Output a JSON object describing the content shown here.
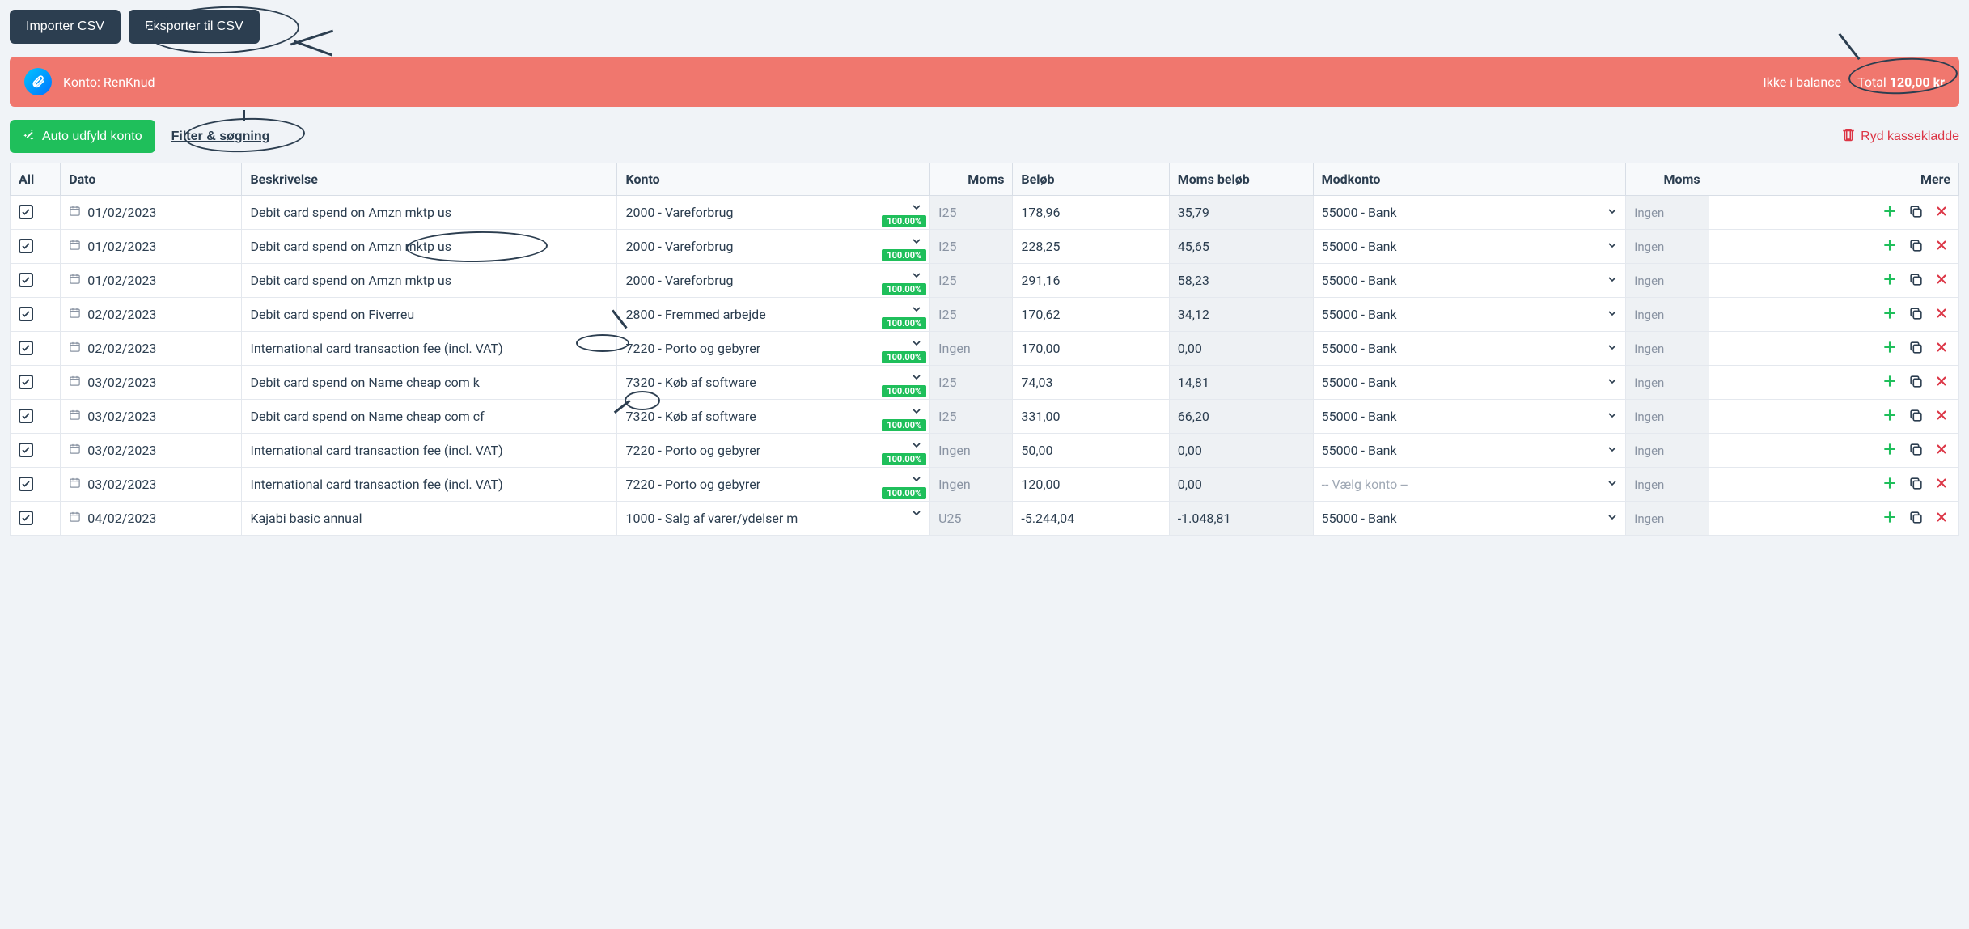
{
  "buttons": {
    "import_csv": "Importer CSV",
    "export_csv": "Eksporter til CSV",
    "auto_fill": "Auto udfyld konto",
    "filter_search": "Filter & søgning",
    "clear_journal": "Ryd kassekladde"
  },
  "banner": {
    "account_label": "Konto:",
    "account_name": "RenKnud",
    "not_balanced": "Ikke i balance",
    "total_label": "Total",
    "total_value": "120,00 kr"
  },
  "table": {
    "headers": {
      "all": "All",
      "date": "Dato",
      "description": "Beskrivelse",
      "account": "Konto",
      "vat": "Moms",
      "amount": "Beløb",
      "vat_amount": "Moms beløb",
      "contra": "Modkonto",
      "vat2": "Moms",
      "more": "Mere"
    },
    "badge_100": "100.00%",
    "moms2_default": "Ingen",
    "modkonto_placeholder": "-- Vælg konto --",
    "rows": [
      {
        "date": "01/02/2023",
        "desc": "Debit card spend on Amzn mktp us",
        "konto": "2000 - Vareforbrug",
        "moms": "I25",
        "amount": "178,96",
        "vat_amount": "35,79",
        "modkonto": "55000 - Bank",
        "has_confidence": true
      },
      {
        "date": "01/02/2023",
        "desc": "Debit card spend on Amzn mktp us",
        "konto": "2000 - Vareforbrug",
        "moms": "I25",
        "amount": "228,25",
        "vat_amount": "45,65",
        "modkonto": "55000 - Bank",
        "has_confidence": true
      },
      {
        "date": "01/02/2023",
        "desc": "Debit card spend on Amzn mktp us",
        "konto": "2000 - Vareforbrug",
        "moms": "I25",
        "amount": "291,16",
        "vat_amount": "58,23",
        "modkonto": "55000 - Bank",
        "has_confidence": true
      },
      {
        "date": "02/02/2023",
        "desc": "Debit card spend on Fiverreu",
        "konto": "2800 - Fremmed arbejde",
        "moms": "I25",
        "amount": "170,62",
        "vat_amount": "34,12",
        "modkonto": "55000 - Bank",
        "has_confidence": true
      },
      {
        "date": "02/02/2023",
        "desc": "International card transaction fee (incl. VAT)",
        "konto": "7220 - Porto og gebyrer",
        "moms": "Ingen",
        "amount": "170,00",
        "vat_amount": "0,00",
        "modkonto": "55000 - Bank",
        "has_confidence": true
      },
      {
        "date": "03/02/2023",
        "desc": "Debit card spend on Name cheap com k",
        "konto": "7320 - Køb af software",
        "moms": "I25",
        "amount": "74,03",
        "vat_amount": "14,81",
        "modkonto": "55000 - Bank",
        "has_confidence": true
      },
      {
        "date": "03/02/2023",
        "desc": "Debit card spend on Name cheap com cf",
        "konto": "7320 - Køb af software",
        "moms": "I25",
        "amount": "331,00",
        "vat_amount": "66,20",
        "modkonto": "55000 - Bank",
        "has_confidence": true
      },
      {
        "date": "03/02/2023",
        "desc": "International card transaction fee (incl. VAT)",
        "konto": "7220 - Porto og gebyrer",
        "moms": "Ingen",
        "amount": "50,00",
        "vat_amount": "0,00",
        "modkonto": "55000 - Bank",
        "has_confidence": true
      },
      {
        "date": "03/02/2023",
        "desc": "International card transaction fee (incl. VAT)",
        "konto": "7220 - Porto og gebyrer",
        "moms": "Ingen",
        "amount": "120,00",
        "vat_amount": "0,00",
        "modkonto": "",
        "has_confidence": true
      },
      {
        "date": "04/02/2023",
        "desc": "Kajabi basic annual",
        "konto": "1000 - Salg af varer/ydelser m",
        "moms": "U25",
        "amount": "-5.244,04",
        "vat_amount": "-1.048,81",
        "modkonto": "55000 - Bank",
        "has_confidence": false
      }
    ]
  }
}
